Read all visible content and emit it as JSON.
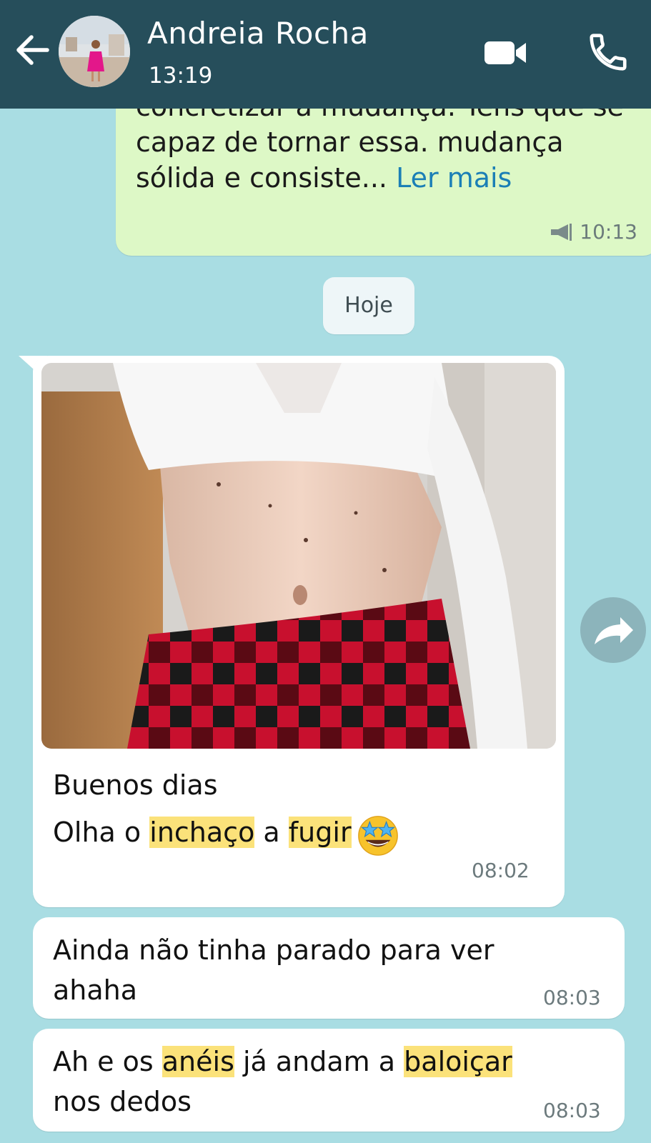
{
  "header": {
    "contact_name": "Andreia Rocha",
    "status": "13:19",
    "icons": [
      "back-arrow-icon",
      "video-call-icon",
      "phone-icon"
    ]
  },
  "outgoing": {
    "line1": "concretizar a mudança. Tens que se",
    "line2": "capaz de tornar essa. mudança",
    "line3": "sólida e consiste...",
    "read_more": "Ler mais",
    "time": "10:13"
  },
  "date_chip": "Hoje",
  "messages": [
    {
      "type": "image",
      "caption_line1": "Buenos dias",
      "caption_line2_a": "Olha o",
      "caption_line2_h1": "inchaço",
      "caption_line2_b": "a",
      "caption_line2_h2": "fugir",
      "emoji": "star-struck-emoji",
      "time": "08:02"
    },
    {
      "type": "text",
      "line1": "Ainda não tinha parado para ver",
      "line2": "ahaha",
      "time": "08:03"
    },
    {
      "type": "text",
      "line1_a": "Ah e os",
      "line1_h1": "anéis",
      "line1_b": "já andam a",
      "line1_h2": "baloiçar",
      "line2": "nos dedos",
      "time": "08:03"
    }
  ],
  "colors": {
    "header_bg": "#264e5b",
    "chat_bg": "#a9dde3",
    "outgoing_bubble": "#ddf8c6",
    "incoming_bubble": "#ffffff",
    "highlight": "#fbe27a",
    "link": "#1b7fb6"
  }
}
